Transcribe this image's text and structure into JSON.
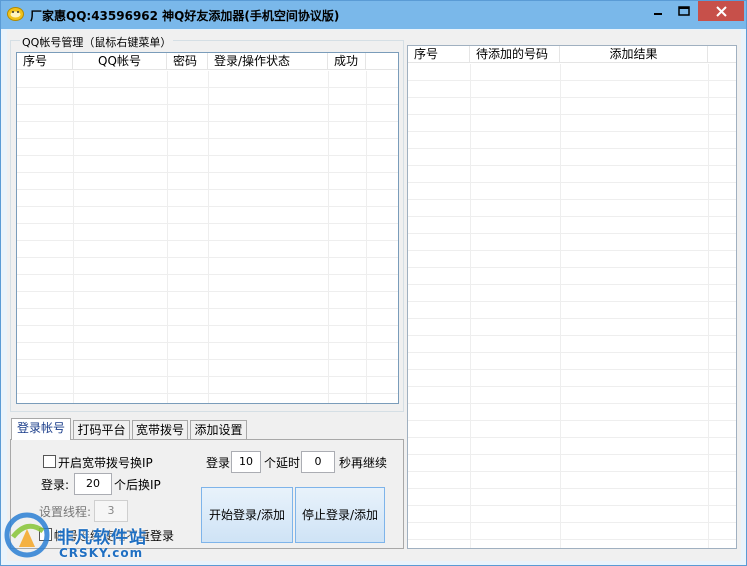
{
  "window": {
    "title": "厂家惠QQ:43596962 神Q好友添加器(手机空间协议版)"
  },
  "accounts": {
    "group_label": "QQ帐号管理（鼠标右键菜单）",
    "columns": [
      "序号",
      "QQ帐号",
      "密码",
      "登录/操作状态",
      "成功"
    ]
  },
  "results": {
    "columns": [
      "序号",
      "待添加的号码",
      "添加结果"
    ]
  },
  "tabs": [
    {
      "label": "登录帐号",
      "active": true
    },
    {
      "label": "打码平台",
      "active": false
    },
    {
      "label": "宽带拨号",
      "active": false
    },
    {
      "label": "添加设置",
      "active": false
    }
  ],
  "login_panel": {
    "broadband_checkbox_label": "开启宽带拨号换IP",
    "login_prefix": "登录",
    "login_count": "10",
    "delay_label": "个延时",
    "delay_seconds": "0",
    "continue_label": "秒再继续",
    "ip_login_prefix": "登录:",
    "ip_login_count": "20",
    "ip_login_suffix": "个后换IP",
    "threads_label": "设置线程:",
    "threads_value": "3",
    "sticky_checkbox_label": "帐号连续使用不重登录",
    "start_button": "开始登录/添加",
    "stop_button": "停止登录/添加"
  },
  "watermark": {
    "cn": "非凡软件站",
    "en": "CRSKY.com"
  },
  "colors": {
    "titlebar": "#7ab8ea",
    "close_button": "#c7504a",
    "active_tab_text": "#1a3d8a",
    "button_border": "#7eb4ea"
  }
}
